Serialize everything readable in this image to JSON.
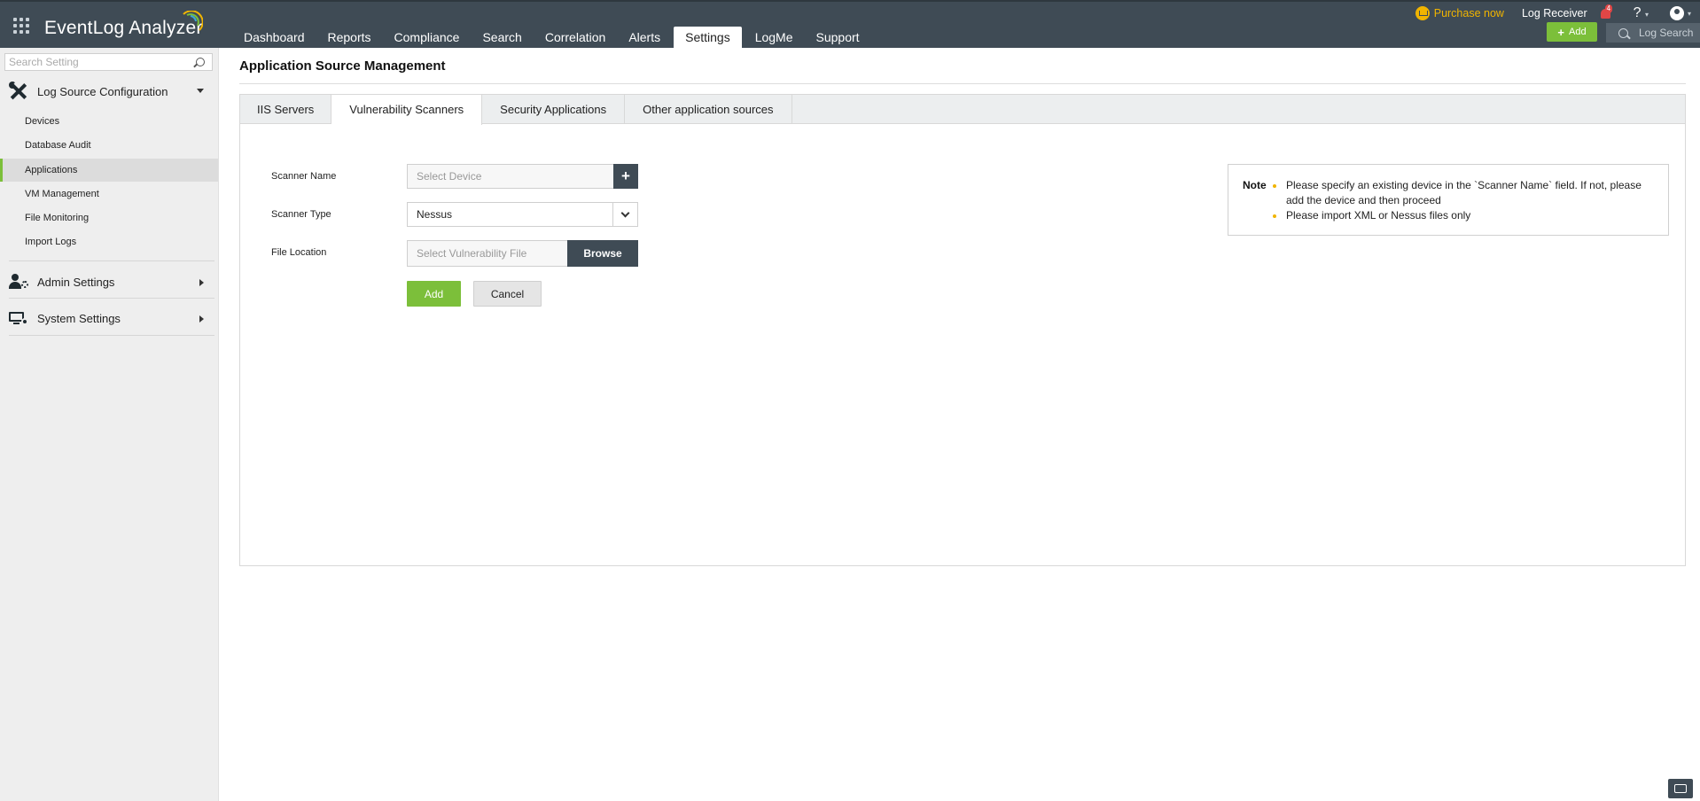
{
  "app": {
    "name": "EventLog Analyzer"
  },
  "nav": {
    "items": [
      "Dashboard",
      "Reports",
      "Compliance",
      "Search",
      "Correlation",
      "Alerts",
      "Settings",
      "LogMe",
      "Support"
    ],
    "active": "Settings"
  },
  "header": {
    "purchase_label": "Purchase now",
    "log_receiver_label": "Log Receiver",
    "notification_count": "4",
    "help_label": "?",
    "add_label": "Add",
    "log_search_placeholder": "Log Search"
  },
  "sidebar": {
    "search_placeholder": "Search Setting",
    "sections": [
      {
        "label": "Log Source Configuration",
        "icon": "tools-icon",
        "expanded": true
      },
      {
        "label": "Admin Settings",
        "icon": "admin-settings-icon",
        "expanded": false
      },
      {
        "label": "System Settings",
        "icon": "system-settings-icon",
        "expanded": false
      }
    ],
    "items": [
      "Devices",
      "Database Audit",
      "Applications",
      "VM Management",
      "File Monitoring",
      "Import Logs"
    ],
    "active_item": "Applications"
  },
  "main": {
    "title": "Application Source Management",
    "tabs": [
      "IIS Servers",
      "Vulnerability Scanners",
      "Security Applications",
      "Other application sources"
    ],
    "active_tab": "Vulnerability Scanners",
    "form": {
      "scanner_name_label": "Scanner Name",
      "scanner_name_placeholder": "Select Device",
      "scanner_type_label": "Scanner Type",
      "scanner_type_value": "Nessus",
      "file_location_label": "File Location",
      "file_location_placeholder": "Select Vulnerability File",
      "browse_label": "Browse",
      "add_label": "Add",
      "cancel_label": "Cancel"
    },
    "note": {
      "title": "Note",
      "items": [
        "Please specify an existing device in the `Scanner Name` field. If not, please add the device and then proceed",
        "Please import XML or Nessus files only"
      ]
    }
  },
  "colors": {
    "topbar": "#3f4b55",
    "accent_green": "#7cbf3a",
    "purchase_yellow": "#f0b400",
    "notification_red": "#e04646"
  }
}
